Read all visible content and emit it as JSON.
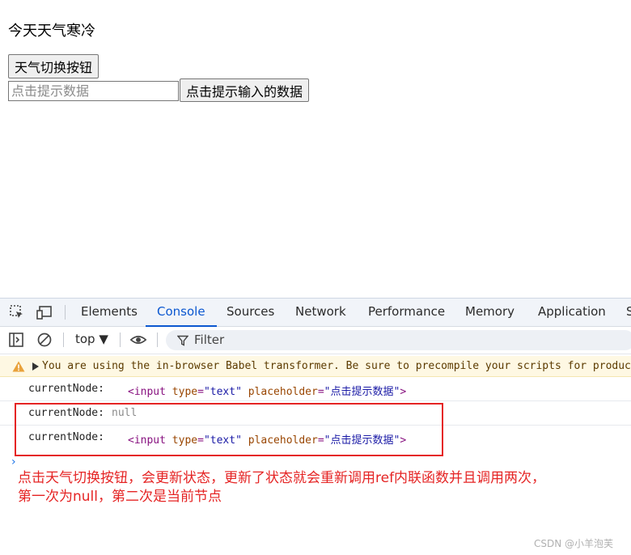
{
  "page": {
    "weather_text": "今天天气寒冷",
    "toggle_button_label": "天气切换按钮",
    "input_placeholder": "点击提示数据",
    "show_button_label": "点击提示输入的数据"
  },
  "devtools": {
    "tabs": [
      "Elements",
      "Console",
      "Sources",
      "Network",
      "Performance",
      "Memory",
      "Application",
      "S"
    ],
    "active_tab": "Console",
    "context_selector": "top ▼",
    "filter_placeholder": "Filter"
  },
  "console": {
    "warning": "You are using the in-browser Babel transformer. Be sure to precompile your scripts for production",
    "logs": [
      {
        "key": "currentNode:",
        "tag_open": "<input ",
        "attr1": "type",
        "eq1": "=",
        "val1": "\"text\"",
        "space": " ",
        "attr2": "placeholder",
        "eq2": "=",
        "val2": "\"点击提示数据\"",
        "tag_close": ">"
      },
      {
        "key": "currentNode:",
        "value": "null"
      },
      {
        "key": "currentNode:",
        "tag_open": "<input ",
        "attr1": "type",
        "eq1": "=",
        "val1": "\"text\"",
        "space": " ",
        "attr2": "placeholder",
        "eq2": "=",
        "val2": "\"点击提示数据\"",
        "tag_close": ">"
      }
    ],
    "prompt": "›"
  },
  "annotation": {
    "line1": "点击天气切换按钮，会更新状态，更新了状态就会重新调用ref内联函数并且调用两次，",
    "line2": "第一次为null，第二次是当前节点"
  },
  "watermark": "CSDN @小羊泡芙",
  "colors": {
    "accent": "#0b57d0",
    "highlight": "#e52424",
    "warning_bg": "#fef8e3"
  }
}
